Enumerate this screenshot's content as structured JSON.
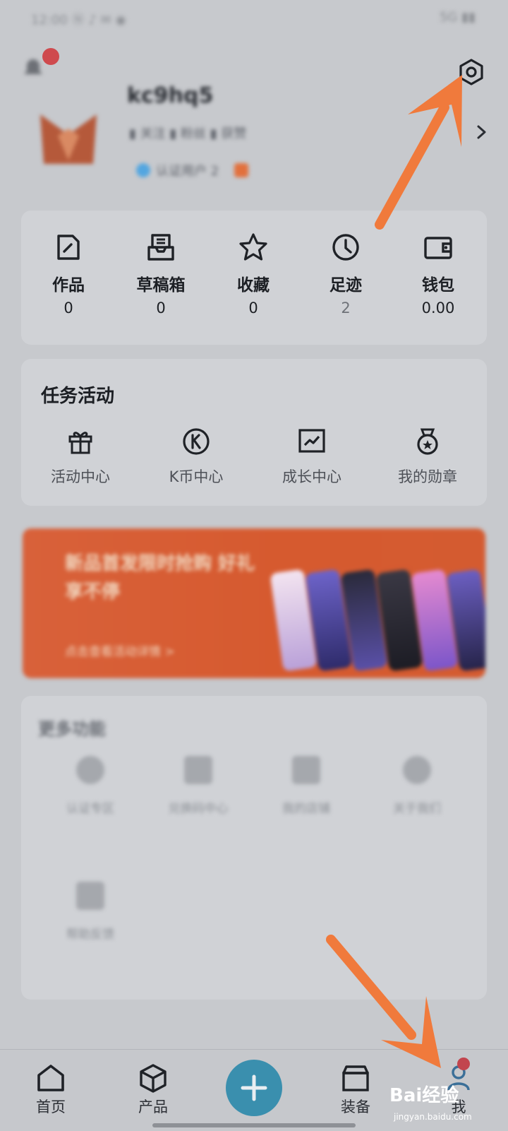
{
  "status_bar": {
    "left_text": "12:00 Ⓝ ♪ ✉ ◉",
    "right_text": "5G ▮▮"
  },
  "profile": {
    "username": "kc9hq5",
    "stats_text": "▮ 关注  ▮ 粉丝  ▮ 获赞",
    "tags_text": "认证用户    2"
  },
  "quick_actions": [
    {
      "label": "作品",
      "value": "0",
      "icon": "edit-doc-icon"
    },
    {
      "label": "草稿箱",
      "value": "0",
      "icon": "inbox-icon"
    },
    {
      "label": "收藏",
      "value": "0",
      "icon": "star-icon"
    },
    {
      "label": "足迹",
      "value": "2",
      "icon": "clock-icon"
    },
    {
      "label": "钱包",
      "value": "0.00",
      "icon": "wallet-icon"
    }
  ],
  "tasks": {
    "title": "任务活动",
    "items": [
      {
        "label": "活动中心",
        "icon": "gift-icon"
      },
      {
        "label": "K币中心",
        "icon": "k-coin-icon"
      },
      {
        "label": "成长中心",
        "icon": "growth-chart-icon"
      },
      {
        "label": "我的勋章",
        "icon": "medal-icon"
      }
    ]
  },
  "banner": {
    "headline": "新品首发限时抢购 好礼享不停",
    "subline": "点击查看活动详情 >"
  },
  "more_functions": {
    "title": "更多功能",
    "items": [
      {
        "label": "认证专区"
      },
      {
        "label": "兑换码中心"
      },
      {
        "label": "我的店铺"
      },
      {
        "label": "关于我们"
      },
      {
        "label": "帮助反馈"
      }
    ]
  },
  "tabbar": {
    "items": [
      {
        "label": "首页",
        "icon": "home-icon"
      },
      {
        "label": "产品",
        "icon": "box-3d-icon"
      },
      {
        "label": "",
        "icon": "plus-icon"
      },
      {
        "label": "装备",
        "icon": "archive-box-icon"
      },
      {
        "label": "我",
        "icon": "user-icon"
      }
    ]
  },
  "watermark": {
    "brand": "Bai经验",
    "url": "jingyan.baidu.com"
  },
  "colors": {
    "annotation_arrow": "#f07a3c",
    "fab": "#3a8fae",
    "badge": "#c2454e",
    "background": "#c7c9cd"
  }
}
